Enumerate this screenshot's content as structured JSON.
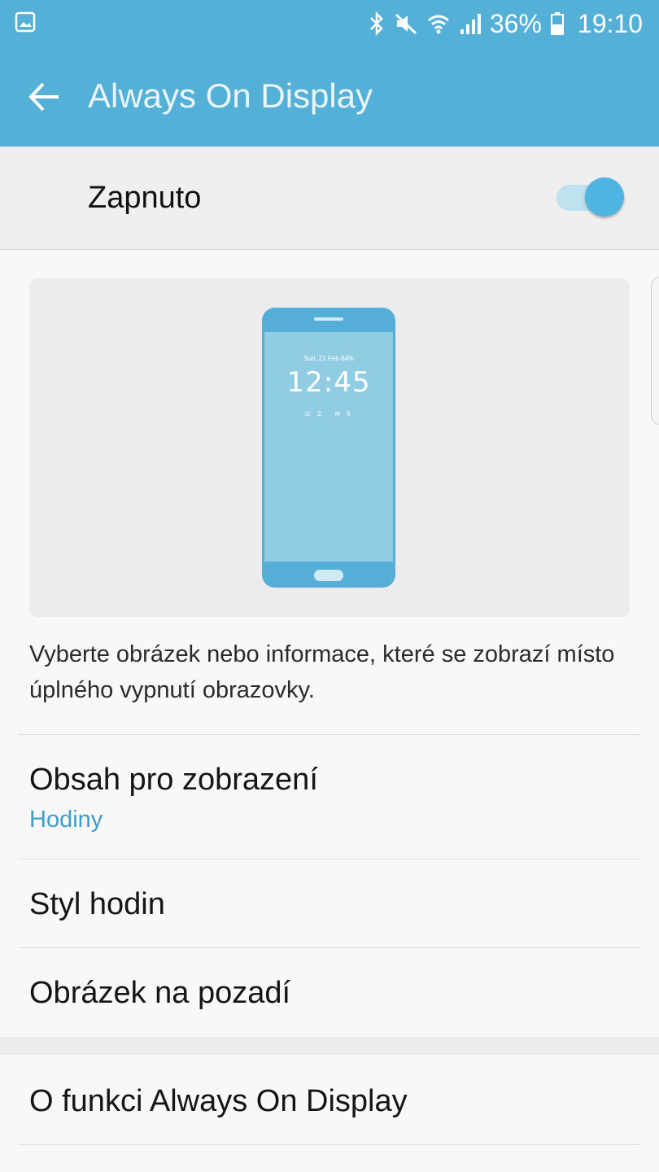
{
  "status_bar": {
    "battery_percent": "36%",
    "time": "19:10",
    "icons": [
      "gallery-icon",
      "bluetooth-icon",
      "mute-icon",
      "wifi-icon",
      "signal-icon",
      "battery-icon"
    ]
  },
  "app_bar": {
    "title": "Always On Display",
    "back_icon": "back-arrow-icon"
  },
  "master_switch": {
    "label": "Zapnuto",
    "state": "on"
  },
  "preview": {
    "date": "Sun, 21 Feb  84%",
    "clock": "12:45",
    "missed_calls": "2",
    "messages": "6"
  },
  "description": "Vyberte obrázek nebo informace, které se zobrazí místo úplného vypnutí obrazovky.",
  "settings": [
    {
      "title": "Obsah pro zobrazení",
      "subtitle": "Hodiny"
    },
    {
      "title": "Styl hodin"
    },
    {
      "title": "Obrázek na pozadí"
    },
    {
      "title": "O funkci Always On Display"
    }
  ],
  "colors": {
    "accent": "#54b0d7",
    "subtitle": "#3d9ec7",
    "toggle_knob": "#50b4e2"
  }
}
